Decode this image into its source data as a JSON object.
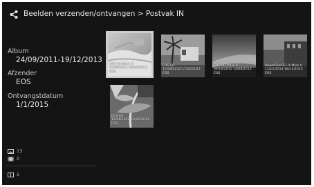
{
  "header": {
    "title": "Beelden verzenden/ontvangen > Postvak IN"
  },
  "info": {
    "album_label": "Album",
    "album_value": "24/09/2011-19/12/2013",
    "afzender_label": "Afzender",
    "afzender_value": "EOS",
    "ontvangstdatum_label": "Ontvangstdatum",
    "ontvangstdatum_value": "1/1/2015"
  },
  "counts": {
    "photos": "13",
    "movies": "0",
    "albums": "5"
  },
  "thumbnails": [
    {
      "line1": "EOS 5D Mark II",
      "line2": "24/09/2011-19/12/2013",
      "line3": "EOS",
      "selected": true
    },
    {
      "line1": "EOS 6D",
      "line2": "13/08/2012-17/12/2013",
      "line3": "EOS"
    },
    {
      "line1": "EOS 5D Mark III",
      "line2": "09/10/2011-14/08/2013",
      "line3": "EOS"
    },
    {
      "line1": "PowerShot G1 X Mark II",
      "line2": "11/12/2013-18/12/2013",
      "line3": "EOS"
    },
    {
      "line1": "EOS 60",
      "line2": "13/08/2012-19/12/2013",
      "line3": "EOS"
    }
  ],
  "colors": {
    "background": "#141414",
    "selection": "#cfcfcf",
    "text": "#e8e8e8"
  }
}
